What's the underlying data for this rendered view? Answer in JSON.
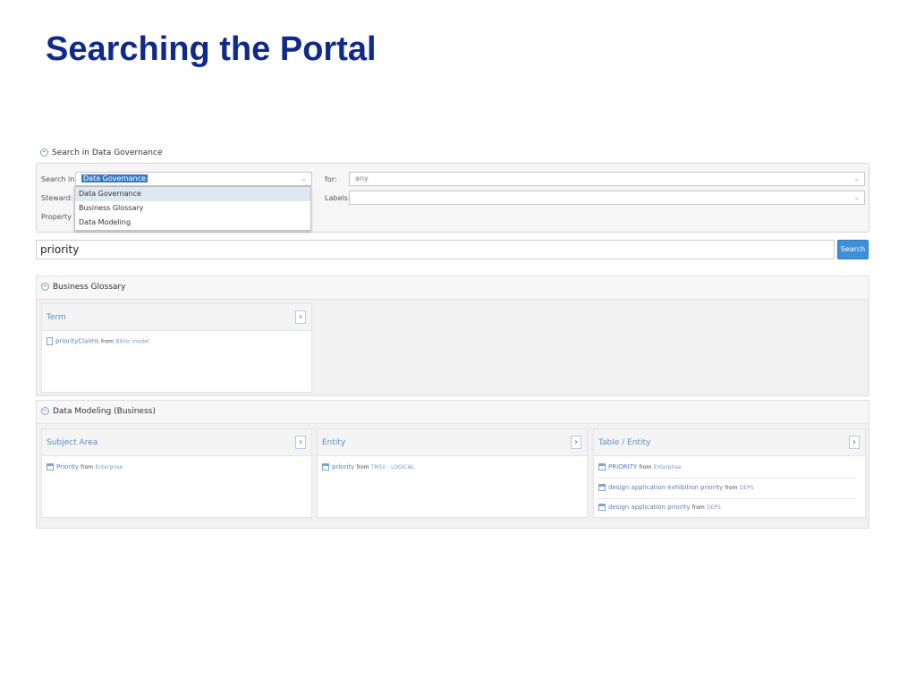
{
  "slide": {
    "title": "Searching the Portal"
  },
  "search_section": {
    "title": "Search in Data Governance"
  },
  "form": {
    "search_in_label": "Search in:",
    "search_in_value": "Data Governance",
    "steward_label": "Steward:",
    "property_type_label": "Property Typ",
    "for_label": "for:",
    "for_value": "any",
    "labels_label": "Labels:",
    "labels_value": ""
  },
  "dropdown": {
    "options": [
      "Data Governance",
      "Business Glossary",
      "Data Modeling"
    ]
  },
  "search": {
    "query": "priority",
    "button_label": "Search"
  },
  "business_glossary": {
    "title": "Business Glossary",
    "columns": [
      {
        "title": "Term",
        "results": [
          {
            "name": "priorityClaims",
            "from": "from",
            "source": "Biblio model"
          }
        ]
      }
    ]
  },
  "data_modeling": {
    "title": "Data Modeling (Business)",
    "columns": [
      {
        "title": "Subject Area",
        "results": [
          {
            "name": "Priority",
            "from": "from",
            "source": "Enterprise"
          }
        ]
      },
      {
        "title": "Entity",
        "results": [
          {
            "name": "priority",
            "from": "from",
            "source": "TM10 - LOGICAL"
          }
        ]
      },
      {
        "title": "Table / Entity",
        "results": [
          {
            "name": "PRIORITY",
            "from": "from",
            "source": "Enterprise"
          },
          {
            "name": "design application exhibition priority",
            "from": "from",
            "source": "DEPS"
          },
          {
            "name": "design application priority",
            "from": "from",
            "source": "DEPS"
          }
        ]
      }
    ]
  },
  "icons": {
    "collapse": "collapse-circle-icon",
    "expand": "chevron-right-icon",
    "term": "document-icon",
    "table": "table-icon"
  }
}
